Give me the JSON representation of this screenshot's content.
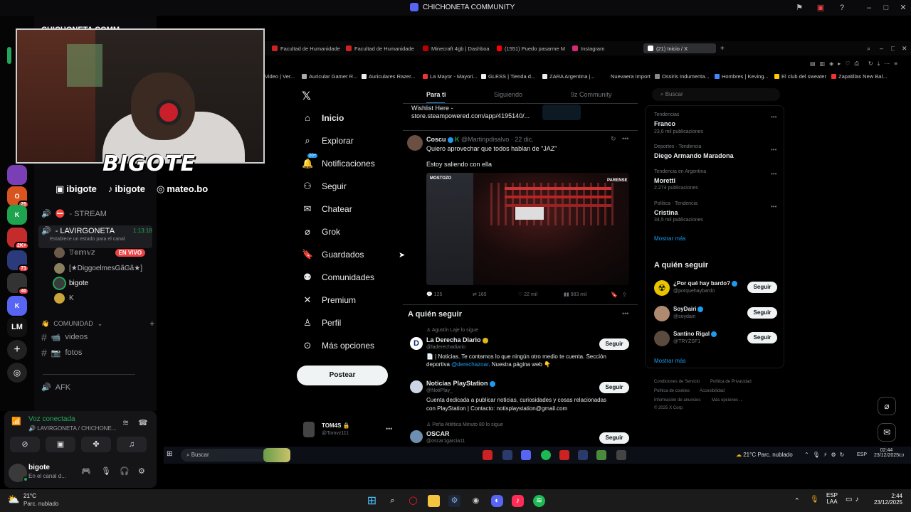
{
  "titlebar": {
    "title": "CHICHONETA COMMUNITY"
  },
  "server_rail": {
    "badges": [
      "25",
      "2K+",
      "71",
      "40"
    ],
    "initials": "LM"
  },
  "channels": {
    "server_name": "CHICHONETA COMM",
    "stream": "- STREAM",
    "lavirgoneta": "- LAVIRGONETA",
    "timer": "1:13:18",
    "status_hint": "Establece un estado para el canal",
    "voice_users": [
      {
        "name": "𝕋𝕠𝕞𝕧𝕫",
        "live": "EN VIVO"
      },
      {
        "name": "[★DiggoelmesGãGã★]"
      },
      {
        "name": "bigote"
      },
      {
        "name": "K"
      }
    ],
    "category": "COMUNIDAD",
    "text_channels": [
      "videos",
      "fotos"
    ],
    "afk": "AFK"
  },
  "overlay": {
    "logo": "BIGOTE",
    "socials": [
      "ibigote",
      "ibigote",
      "mateo.bo"
    ]
  },
  "voice_panel": {
    "status": "Voz conectada",
    "channel": "LAVIRGONETA / CHICHONE..."
  },
  "user_panel": {
    "username": "bigote",
    "substatus": "En el canal d..."
  },
  "browser": {
    "tabs": [
      "Facultad de Humanidade",
      "Facultad de Humanidade",
      "Minecraft 4gb | Dashboa",
      "(1551) Puedo pasarme M",
      "Instagram",
      "(21) Inicio / X"
    ],
    "bookmarks": [
      "Video | Ver...",
      "Auricular Gamer R...",
      "Auriculares Razer...",
      "La Mayor - Mayori...",
      "GLESS | Tienda d...",
      "ZARA Argentina |...",
      "Nuevaera Import",
      "Ossiris Indumenta...",
      "Hombres | Keving...",
      "El club del sweater",
      "Zapatillas New Bal..."
    ]
  },
  "x_nav": {
    "items": [
      "Inicio",
      "Explorar",
      "Notificaciones",
      "Seguir",
      "Chatear",
      "Grok",
      "Guardados",
      "Comunidades",
      "Premium",
      "Perfil",
      "Más opciones"
    ],
    "notif_badge": "20+",
    "post": "Postear",
    "account_name": "TOM4S",
    "account_handle": "@Tomvz111"
  },
  "feed": {
    "tabs": [
      "Para ti",
      "Siguiendo",
      "9z Community"
    ],
    "prev_post_line1": "Wishlist Here -",
    "prev_post_line2": "store.steampowered.com/app/4195140/...",
    "post": {
      "author": "Coscu",
      "handle": "@Martinpdisalvo",
      "date": "22 dic.",
      "text": "Quiero aprovechar que todos hablan de \"JAZ\"",
      "text2": "Estoy saliendo con ella",
      "image_tag_left": "MOSTOZO",
      "image_tag_right": "PARENSE",
      "stats": [
        "125",
        "165",
        "22 mil",
        "983 mil"
      ]
    },
    "who_to_follow": {
      "title": "A quién seguir",
      "accounts": [
        {
          "context": "Agustín Laje lo sigue",
          "name": "La Derecha Diario",
          "handle": "@laderechadiario",
          "bio": "📄 | Noticias. Te contamos lo que ningún otro medio te cuenta. Sección",
          "bio2_pre": "deportiva ",
          "bio2_link": "@derechazoar",
          "bio2_post": ". Nuestra página web 👇",
          "button": "Seguir"
        },
        {
          "name": "Noticias PlayStation",
          "handle": "@NotiPlay_",
          "bio": "Cuenta dedicada a publicar noticias, curiosidades y cosas relacionadas",
          "bio2": "con PlayStation | Contacto: notisplaystation@gmail.com",
          "button": "Seguir"
        },
        {
          "context": "Peña Atlética Minuto 80 lo sigue",
          "name": "OSCAR",
          "handle": "@oscar1garcia11",
          "button": "Seguir"
        }
      ]
    }
  },
  "sidebar": {
    "search_placeholder": "Buscar",
    "trends": [
      {
        "category": "Tendencias",
        "name": "Franco",
        "count": "23,6 mil publicaciones"
      },
      {
        "category": "Deportes · Tendencia",
        "name": "Diego Armando Maradona",
        "count": ""
      },
      {
        "category": "Tendencia en Argentina",
        "name": "Moretti",
        "count": "2.274 publicaciones"
      },
      {
        "category": "Política · Tendencia",
        "name": "Cristina",
        "count": "34,5 mil publicaciones"
      }
    ],
    "show_more": "Mostrar más",
    "follow_title": "A quién seguir",
    "follow": [
      {
        "name": "¿Por qué hay bardo?",
        "handle": "@porquehaybardo",
        "button": "Seguir"
      },
      {
        "name": "SoyDairi",
        "handle": "@soydairi",
        "button": "Seguir"
      },
      {
        "name": "Santino Rigal",
        "handle": "@TRYZSF1",
        "button": "Seguir"
      }
    ],
    "show_more2": "Mostrar más",
    "footer": [
      "Condiciones de Servicio",
      "Política de Privacidad",
      "Política de cookies",
      "Accesibilidad",
      "Información de anuncios",
      "Más opciones ...",
      "© 2025 X Corp."
    ]
  },
  "inner_taskbar": {
    "search": "Buscar",
    "weather": "21°C  Parc. nublado",
    "lang": "ESP",
    "time": "02:44",
    "date": "23/12/2025"
  },
  "taskbar": {
    "temp": "21°C",
    "weather": "Parc. nublado",
    "lang1": "ESP",
    "lang2": "LAA",
    "time": "2:44",
    "date": "23/12/2025"
  },
  "colors": {
    "x_blue": "#1d9bf0",
    "discord_green": "#23a55a",
    "live_red": "#ed4245"
  }
}
